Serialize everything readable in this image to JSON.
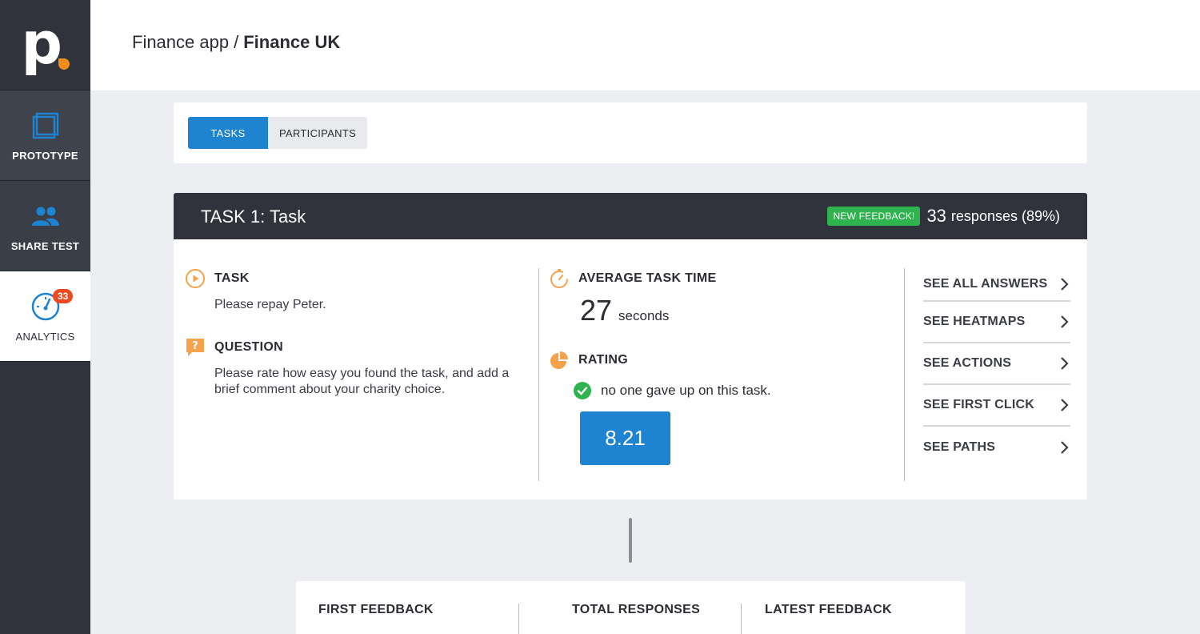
{
  "sidebar": {
    "logo_text": "p",
    "items": [
      {
        "label": "PROTOTYPE",
        "icon": "prototype-icon"
      },
      {
        "label": "SHARE TEST",
        "icon": "people-icon"
      },
      {
        "label": "ANALYTICS",
        "icon": "gauge-icon",
        "badge": "33"
      }
    ]
  },
  "header": {
    "breadcrumb_parent": "Finance app",
    "breadcrumb_separator": "/",
    "breadcrumb_current": "Finance UK"
  },
  "tabs": [
    {
      "label": "TASKS",
      "active": true
    },
    {
      "label": "PARTICIPANTS",
      "active": false
    }
  ],
  "task": {
    "title": "TASK 1: Task",
    "new_feedback_label": "NEW FEEDBACK!",
    "response_count": "33",
    "response_text": "responses (89%)",
    "task_heading": "TASK",
    "task_text": "Please repay Peter.",
    "question_heading": "QUESTION",
    "question_text": "Please rate how easy you found the task, and add a brief comment about your charity choice.",
    "avg_time_heading": "AVERAGE TASK TIME",
    "avg_time_value": "27",
    "avg_time_unit": "seconds",
    "rating_heading": "RATING",
    "gave_up_text": "no one gave up on this task.",
    "rating_value": "8.21",
    "links": [
      "SEE ALL ANSWERS",
      "SEE HEATMAPS",
      "SEE ACTIONS",
      "SEE FIRST CLICK",
      "SEE PATHS"
    ]
  },
  "summary": {
    "first_feedback": "FIRST FEEDBACK",
    "total_responses": "TOTAL RESPONSES",
    "latest_feedback": "LATEST FEEDBACK"
  },
  "colors": {
    "accent": "#1e83d1",
    "sidebar": "#30333b",
    "orange": "#f5a24b",
    "success": "#2fb34f",
    "badge": "#f0491f"
  }
}
